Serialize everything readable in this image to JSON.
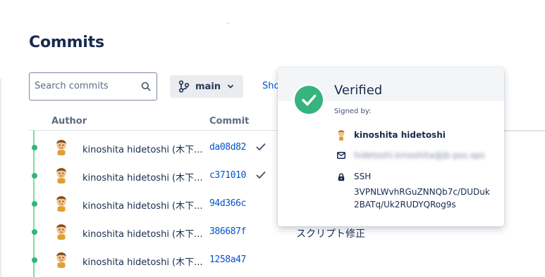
{
  "page": {
    "title": "Commits"
  },
  "toolbar": {
    "search_placeholder": "Search commits",
    "branch_label": "main",
    "show_label": "Sho"
  },
  "table": {
    "columns": {
      "author": "Author",
      "commit": "Commit"
    },
    "rows": [
      {
        "author": "kinoshita hidetoshi (木下...",
        "hash": "da08d82",
        "verified": true,
        "message": ""
      },
      {
        "author": "kinoshita hidetoshi (木下...",
        "hash": "c371010",
        "verified": true,
        "message": ""
      },
      {
        "author": "kinoshita hidetoshi (木下...",
        "hash": "94d366c",
        "verified": false,
        "message": ""
      },
      {
        "author": "kinoshita hidetoshi (木下...",
        "hash": "386687f",
        "verified": false,
        "message": "スクリプト修正"
      },
      {
        "author": "kinoshita hidetoshi (木下...",
        "hash": "1258a47",
        "verified": false,
        "message": ""
      }
    ]
  },
  "popover": {
    "title": "Verified",
    "signed_by_label": "Signed by:",
    "signer_name": "kinoshita hidetoshi",
    "email_blurred": "hidetoshi.kinoshita@jb-pss.ops",
    "key_type": "SSH",
    "fingerprint": "3VPNLWvhRGuZNNQb7c/DUDuk2BATq/Uk2RUDYQRog9s"
  },
  "colors": {
    "accent_link": "#0052cc",
    "success": "#36b37e",
    "timeline": "#79e2a5",
    "text_primary": "#172b4d",
    "button_bg": "#ebecf0"
  },
  "icons": {
    "search": "search-icon",
    "branch": "branch-icon",
    "chevron": "chevron-down-icon",
    "check": "check-icon",
    "verified": "verified-check-icon",
    "mail": "mail-icon",
    "lock": "lock-icon",
    "avatar": "avatar"
  }
}
